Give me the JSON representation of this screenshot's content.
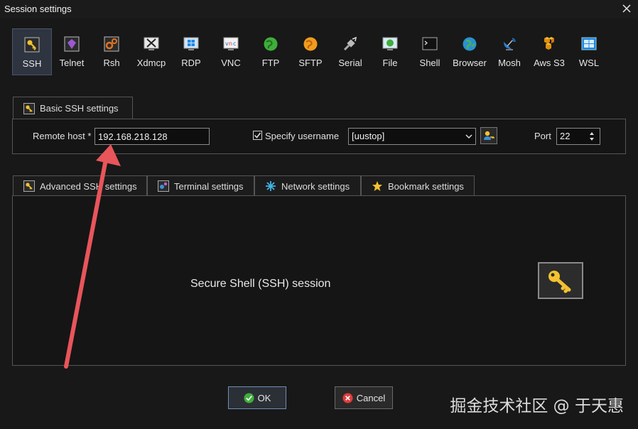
{
  "window": {
    "title": "Session settings"
  },
  "session_types": [
    {
      "label": "SSH",
      "icon": "key-icon"
    },
    {
      "label": "Telnet",
      "icon": "gem-icon"
    },
    {
      "label": "Rsh",
      "icon": "gears-icon"
    },
    {
      "label": "Xdmcp",
      "icon": "x-server-icon"
    },
    {
      "label": "RDP",
      "icon": "windows-monitor-icon"
    },
    {
      "label": "VNC",
      "icon": "vnc-monitor-icon"
    },
    {
      "label": "FTP",
      "icon": "green-globe-icon"
    },
    {
      "label": "SFTP",
      "icon": "orange-globe-icon"
    },
    {
      "label": "Serial",
      "icon": "satellite-icon"
    },
    {
      "label": "File",
      "icon": "file-monitor-icon"
    },
    {
      "label": "Shell",
      "icon": "terminal-icon"
    },
    {
      "label": "Browser",
      "icon": "browser-globe-icon"
    },
    {
      "label": "Mosh",
      "icon": "dish-icon"
    },
    {
      "label": "Aws S3",
      "icon": "aws-boxes-icon"
    },
    {
      "label": "WSL",
      "icon": "wsl-windows-icon"
    }
  ],
  "basic_tab": {
    "label": "Basic SSH settings"
  },
  "basic": {
    "remote_host_label": "Remote host *",
    "remote_host_value": "192.168.218.128",
    "specify_username_label": "Specify username",
    "specify_username_checked": true,
    "username_value": "[uustop]",
    "port_label": "Port",
    "port_value": "22"
  },
  "lower_tabs": [
    {
      "label": "Advanced SSH settings",
      "icon": "key-icon"
    },
    {
      "label": "Terminal settings",
      "icon": "terminal-gear-icon"
    },
    {
      "label": "Network settings",
      "icon": "network-star-icon"
    },
    {
      "label": "Bookmark settings",
      "icon": "star-icon"
    }
  ],
  "panel": {
    "description": "Secure Shell (SSH) session"
  },
  "buttons": {
    "ok": "OK",
    "cancel": "Cancel"
  },
  "watermark": "掘金技术社区 @ 于天惠",
  "colors": {
    "background": "#181818",
    "active_tool": "#2e3440",
    "arrow": "#e8555a",
    "border": "#555555"
  }
}
